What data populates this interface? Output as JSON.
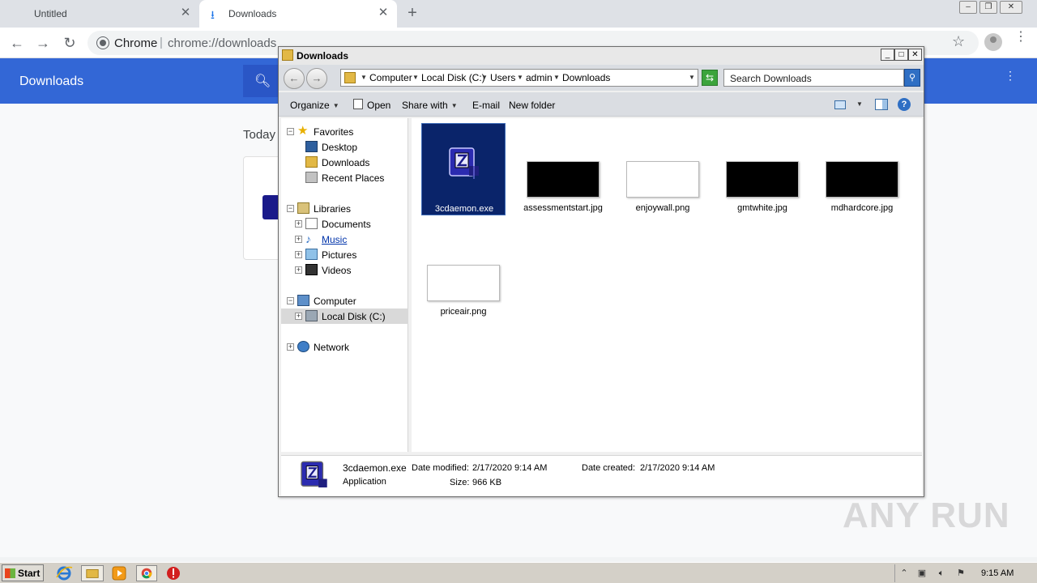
{
  "chrome": {
    "tabs": [
      {
        "label": "Untitled"
      },
      {
        "label": "Downloads"
      }
    ],
    "omnibox": {
      "scheme_label": "Chrome",
      "separator": "|",
      "url": "chrome://downloads"
    },
    "downloads_page": {
      "header_title": "Downloads",
      "section_today": "Today"
    }
  },
  "explorer": {
    "title": "Downloads",
    "breadcrumb": [
      "Computer",
      "Local Disk (C:)",
      "Users",
      "admin",
      "Downloads"
    ],
    "search_placeholder": "Search Downloads",
    "toolbar": {
      "organize": "Organize",
      "open": "Open",
      "share_with": "Share with",
      "email": "E-mail",
      "new_folder": "New folder"
    },
    "nav": {
      "favorites": "Favorites",
      "desktop": "Desktop",
      "downloads": "Downloads",
      "recent_places": "Recent Places",
      "libraries": "Libraries",
      "documents": "Documents",
      "music": "Music",
      "pictures": "Pictures",
      "videos": "Videos",
      "computer": "Computer",
      "local_disk": "Local Disk (C:)",
      "network": "Network"
    },
    "files": [
      {
        "name": "3cdaemon.exe",
        "selected": true
      },
      {
        "name": "assessmentstart.jpg"
      },
      {
        "name": "enjoywall.png"
      },
      {
        "name": "gmtwhite.jpg"
      },
      {
        "name": "mdhardcore.jpg"
      },
      {
        "name": "priceair.png"
      }
    ],
    "details": {
      "filename": "3cdaemon.exe",
      "type": "Application",
      "modified_label": "Date modified:",
      "modified_value": "2/17/2020 9:14 AM",
      "created_label": "Date created:",
      "created_value": "2/17/2020 9:14 AM",
      "size_label": "Size:",
      "size_value": "966 KB"
    }
  },
  "taskbar": {
    "start_label": "Start",
    "clock": "9:15 AM"
  },
  "watermark": "ANY RUN",
  "colors": {
    "chrome_header_blue": "#3367d6",
    "selection_navy": "#0a246a",
    "taskbar_gray": "#d4d0c8"
  }
}
